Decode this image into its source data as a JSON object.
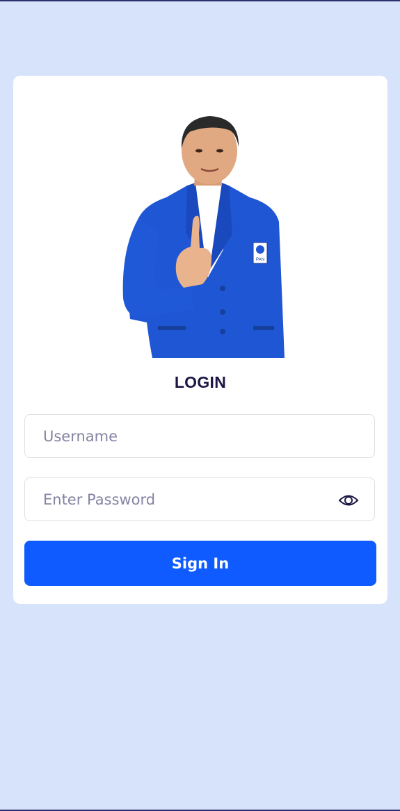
{
  "login": {
    "title": "LOGIN",
    "username_placeholder": "Username",
    "password_placeholder": "Enter Password",
    "signin_label": "Sign In",
    "password_toggle_icon": "eye-icon"
  },
  "photo": {
    "badge_text": "PAN"
  },
  "colors": {
    "background": "#d6e3fb",
    "card": "#ffffff",
    "primary": "#0f5bff",
    "title": "#1c1745",
    "placeholder": "#8483a3"
  }
}
